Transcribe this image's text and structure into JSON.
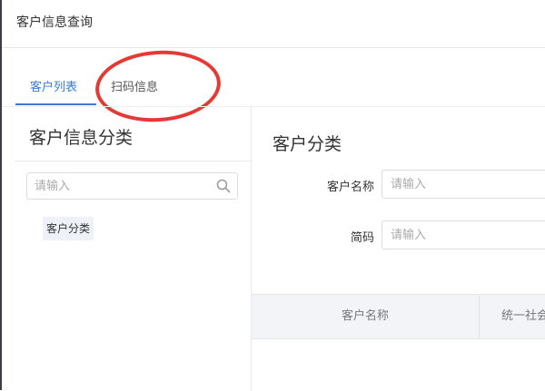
{
  "window": {
    "title": "客户信息查询"
  },
  "tabs": [
    {
      "label": "客户列表",
      "active": true
    },
    {
      "label": "扫码信息",
      "active": false
    }
  ],
  "left_panel": {
    "heading": "客户信息分类",
    "search": {
      "placeholder": "请输入",
      "value": ""
    },
    "tree": [
      {
        "label": "客户分类"
      }
    ]
  },
  "right_panel": {
    "heading": "客户分类",
    "fields": [
      {
        "label": "客户名称",
        "placeholder": "请输入",
        "value": ""
      },
      {
        "label": "简码",
        "placeholder": "请输入",
        "value": ""
      }
    ],
    "table": {
      "columns": [
        "客户名称",
        "统一社会"
      ]
    }
  },
  "colors": {
    "accent": "#3a7bd5",
    "annotation": "#e53935"
  },
  "icons": {
    "search": "search-icon"
  }
}
